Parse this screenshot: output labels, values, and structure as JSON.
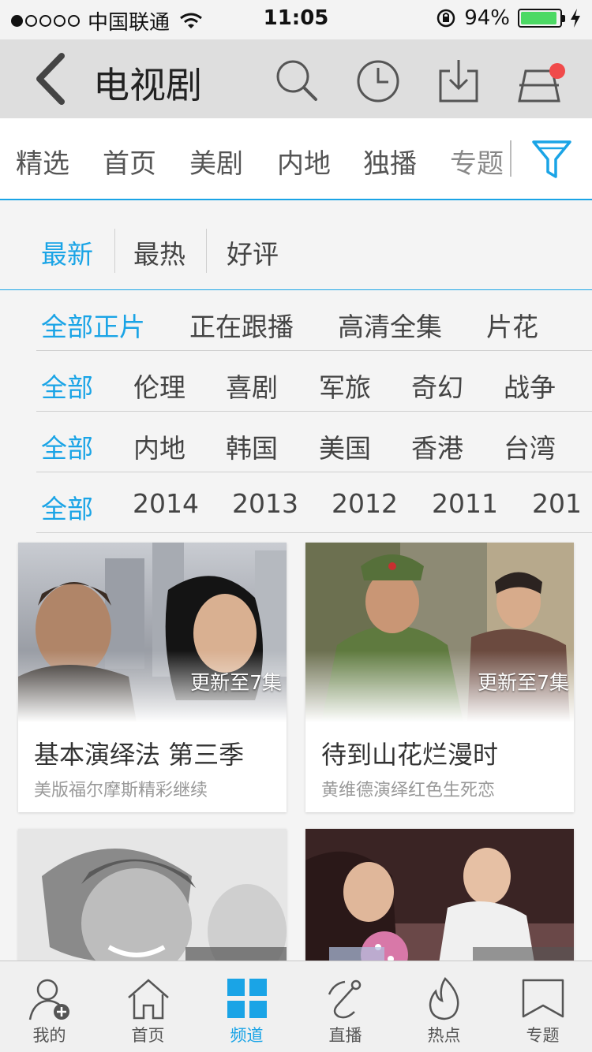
{
  "status_bar": {
    "carrier": "中国联通",
    "time": "11:05",
    "battery": "94%",
    "battery_level": 0.94
  },
  "nav": {
    "title": "电视剧",
    "icons": [
      "back-icon",
      "search-icon",
      "history-icon",
      "download-icon",
      "shopping-bag-icon"
    ]
  },
  "tabs": [
    "精选",
    "首页",
    "美剧",
    "内地",
    "独播",
    "专题"
  ],
  "sort": {
    "items": [
      "最新",
      "最热",
      "好评"
    ],
    "active_index": 0
  },
  "filters": [
    {
      "options": [
        "全部正片",
        "正在跟播",
        "高清全集",
        "片花"
      ],
      "active_index": 0
    },
    {
      "options": [
        "全部",
        "伦理",
        "喜剧",
        "军旅",
        "奇幻",
        "战争"
      ],
      "active_index": 0
    },
    {
      "options": [
        "全部",
        "内地",
        "韩国",
        "美国",
        "香港",
        "台湾"
      ],
      "active_index": 0
    },
    {
      "options": [
        "全部",
        "2014",
        "2013",
        "2012",
        "2011",
        "201"
      ],
      "active_index": 0
    }
  ],
  "cards": [
    {
      "title": "基本演绎法 第三季",
      "subtitle": "美版福尔摩斯精彩继续",
      "update": "更新至7集"
    },
    {
      "title": "待到山花烂漫时",
      "subtitle": "黄维德演绎红色生死恋",
      "update": "更新至7集"
    },
    {
      "title": "",
      "subtitle": "",
      "update": ""
    },
    {
      "title": "",
      "subtitle": "",
      "update": ""
    }
  ],
  "bottom_tabs": [
    {
      "label": "我的",
      "icon": "profile-add-icon"
    },
    {
      "label": "首页",
      "icon": "home-icon"
    },
    {
      "label": "频道",
      "icon": "channel-grid-icon"
    },
    {
      "label": "直播",
      "icon": "live-icon"
    },
    {
      "label": "热点",
      "icon": "flame-icon"
    },
    {
      "label": "专题",
      "icon": "bookmark-icon"
    }
  ],
  "bottom_active_index": 2,
  "colors": {
    "accent": "#1aa4e6",
    "badge": "#f04a4a",
    "battery": "#4cd964"
  }
}
